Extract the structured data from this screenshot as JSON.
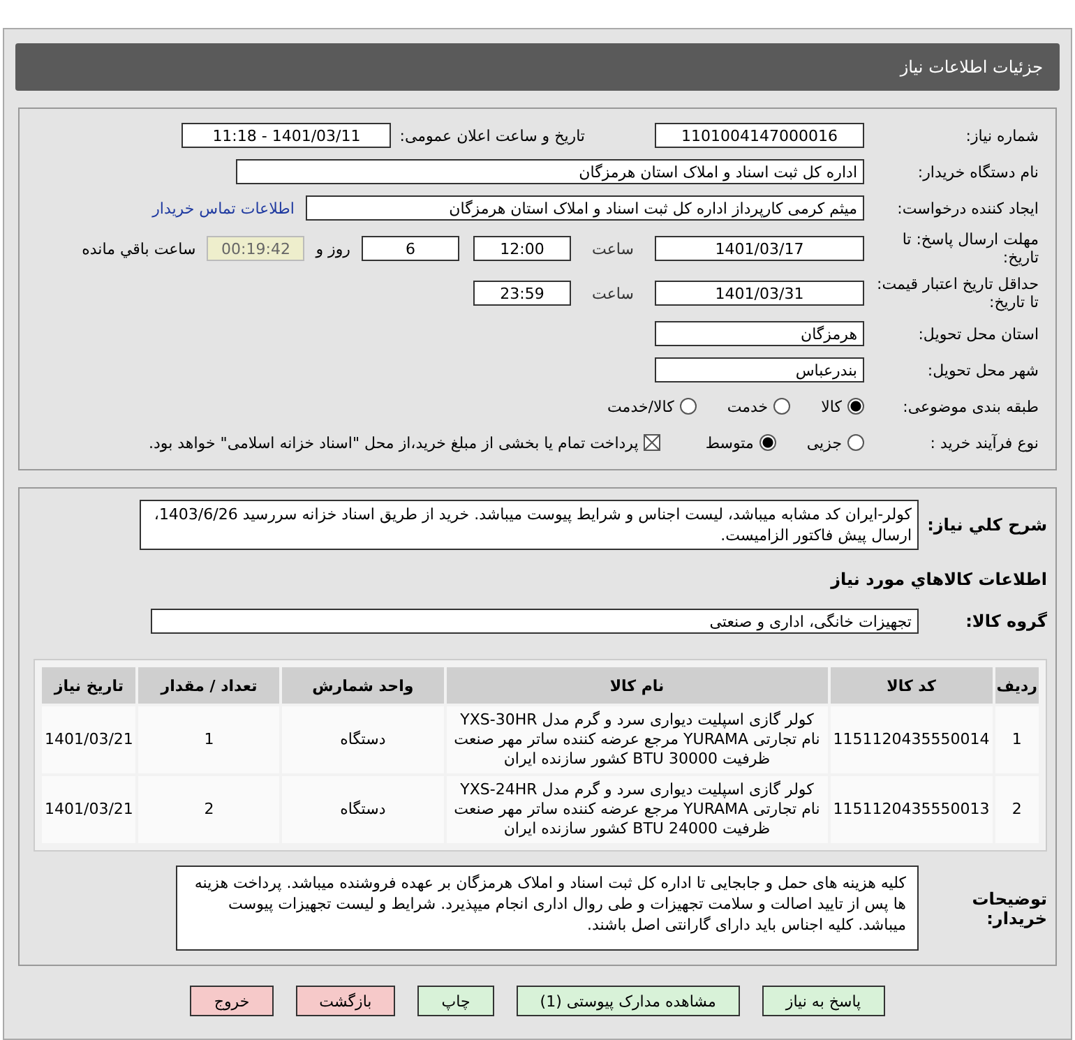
{
  "header": {
    "title": "جزئیات اطلاعات نیاز"
  },
  "need_number": {
    "label": "شماره نیاز:",
    "value": "1101004147000016"
  },
  "announce": {
    "label": "تاریخ و ساعت اعلان عمومی:",
    "value": "1401/03/11 - 11:18"
  },
  "buyer": {
    "label": "نام دستگاه خریدار:",
    "value": "اداره کل ثبت اسناد و املاک استان هرمزگان"
  },
  "requester": {
    "label": "ایجاد کننده درخواست:",
    "value": "میثم کرمی کارپرداز اداره کل ثبت اسناد و املاک استان هرمزگان",
    "link": "اطلاعات تماس خریدار"
  },
  "deadline": {
    "label": "مهلت ارسال پاسخ: تا تاریخ:",
    "date": "1401/03/17",
    "time_label": "ساعت",
    "time": "12:00",
    "days": "6",
    "days_label": "روز و",
    "remaining": "00:19:42",
    "remaining_label": "ساعت باقي مانده"
  },
  "validity": {
    "label": "حداقل تاریخ اعتبار قیمت: تا تاریخ:",
    "date": "1401/03/31",
    "time_label": "ساعت",
    "time": "23:59"
  },
  "province": {
    "label": "استان محل تحویل:",
    "value": "هرمزگان"
  },
  "city": {
    "label": "شهر محل تحویل:",
    "value": "بندرعباس"
  },
  "category": {
    "label": "طبقه بندی موضوعی:",
    "options": [
      {
        "label": "کالا",
        "selected": true
      },
      {
        "label": "خدمت",
        "selected": false
      },
      {
        "label": "کالا/خدمت",
        "selected": false
      }
    ]
  },
  "process": {
    "label": "نوع فرآیند خرید :",
    "options": [
      {
        "label": "جزیی",
        "selected": false
      },
      {
        "label": "متوسط",
        "selected": true
      }
    ],
    "treasury": {
      "checked": true,
      "text": "پرداخت تمام یا بخشی از مبلغ خرید،از محل \"اسناد خزانه اسلامی\" خواهد بود."
    }
  },
  "description": {
    "label": "شرح کلي نیاز:",
    "text": "کولر-ایران کد مشابه میباشد، لیست اجناس و شرایط پیوست میباشد. خرید از طریق اسناد خزانه سررسید 1403/6/26، ارسال پیش فاکتور الزامیست."
  },
  "items_heading": "اطلاعات کالاهاي مورد نیاز",
  "goods_group": {
    "label": "گروه کالا:",
    "value": "تجهیزات خانگی، اداری و صنعتی"
  },
  "table": {
    "columns": [
      "ردیف",
      "کد کالا",
      "نام کالا",
      "واحد شمارش",
      "تعداد / مقدار",
      "تاریخ نیاز"
    ],
    "rows": [
      [
        "1",
        "1151120435550014",
        "کولر گازی اسپلیت دیواری سرد و گرم مدل YXS-30HR نام تجارتی YURAMA مرجع عرضه کننده ساتر مهر صنعت ظرفیت BTU 30000 کشور سازنده ایران",
        "دستگاه",
        "1",
        "1401/03/21"
      ],
      [
        "2",
        "1151120435550013",
        "کولر گازی اسپلیت دیواری سرد و گرم مدل YXS-24HR نام تجارتی YURAMA مرجع عرضه کننده ساتر مهر صنعت ظرفیت BTU 24000 کشور سازنده ایران",
        "دستگاه",
        "2",
        "1401/03/21"
      ]
    ]
  },
  "buyer_notes": {
    "label": "توضیحات خریدار:",
    "text": "کلیه هزینه های حمل و جابجایی تا اداره کل ثبت اسناد و املاک هرمزگان بر عهده فروشنده میباشد. پرداخت هزینه ها پس از تایید اصالت و سلامت تجهیزات و طی روال اداری انجام میپذیرد. شرایط و لیست تجهیزات پیوست میباشد. کلیه اجناس باید دارای گارانتی اصل باشند."
  },
  "buttons": [
    {
      "label": "پاسخ به نیاز",
      "kind": "action"
    },
    {
      "label": "مشاهده مدارک پیوستی (1)",
      "kind": "action"
    },
    {
      "label": "چاپ",
      "kind": "action"
    },
    {
      "label": "بازگشت",
      "kind": "exit"
    },
    {
      "label": "خروج",
      "kind": "exit"
    }
  ]
}
